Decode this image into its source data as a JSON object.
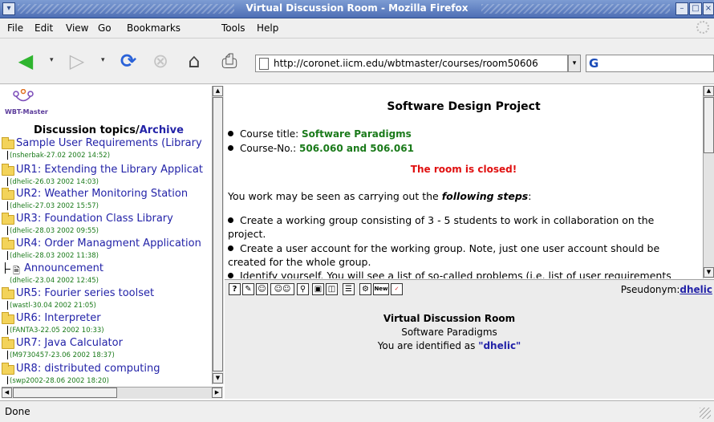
{
  "window": {
    "title": "Virtual Discussion Room - Mozilla Firefox"
  },
  "menu": {
    "items": [
      "File",
      "Edit",
      "View",
      "Go",
      "Bookmarks",
      "Tools",
      "Help"
    ]
  },
  "navigation": {
    "url": "http://coronet.iicm.edu/wbtmaster/courses/room50606"
  },
  "left_frame": {
    "logo_text": "WBT-Master",
    "heading_prefix": "Discussion topics/",
    "heading_archive": "Archive",
    "topics": [
      {
        "label": "Sample User Requirements (Library",
        "meta": "(nsherbak-27.02 2002 14:52)"
      },
      {
        "label": "UR1: Extending the Library Applicat",
        "meta": "(dhelic-26.03 2002 14:03)"
      },
      {
        "label": "UR2: Weather Monitoring Station",
        "meta": "(dhelic-27.03 2002 15:57)"
      },
      {
        "label": "UR3: Foundation Class Library",
        "meta": "(dhelic-28.03 2002 09:55)"
      },
      {
        "label": "UR4: Order Managment Application",
        "meta": "(dhelic-28.03 2002 11:38)"
      },
      {
        "label": "Announcement",
        "meta": "(dhelic-23.04 2002 12:45)"
      },
      {
        "label": "UR5: Fourier series toolset",
        "meta": "(wastl-30.04 2002 21:05)"
      },
      {
        "label": "UR6: Interpreter",
        "meta": "(FANTA3-22.05 2002 10:33)"
      },
      {
        "label": "UR7: Java Calculator",
        "meta": "(M9730457-23.06 2002 18:37)"
      },
      {
        "label": "UR8: distributed computing",
        "meta": "(swp2002-28.06 2002 18:20)"
      }
    ]
  },
  "main_frame": {
    "title": "Software Design Project",
    "course_title_label": "Course title: ",
    "course_title_value": "Software Paradigms",
    "course_no_label": "Course-No.: ",
    "course_no_value": "506.060 and 506.061",
    "closed_notice": "The room is closed!",
    "intro_prefix": "You work may be seen as carrying out the ",
    "intro_emphasis": "following steps",
    "intro_suffix": ":",
    "steps": [
      "Create a working group consisting of 3 - 5 students to work in collaboration on the project.",
      "Create a user account for the working group. Note, just one user account should be created for the whole group.",
      "Identify yourself. You will see a list of so-called problems (i.e. list of user requirements"
    ]
  },
  "room_toolbar": {
    "pseudonym_label": "Pseudonym:",
    "pseudonym_value": "dhelic"
  },
  "room_info": {
    "title": "Virtual Discussion Room",
    "course": "Software Paradigms",
    "identified_prefix": "You are identified as ",
    "identified_user": "\"dhelic\""
  },
  "status": {
    "text": "Done"
  }
}
